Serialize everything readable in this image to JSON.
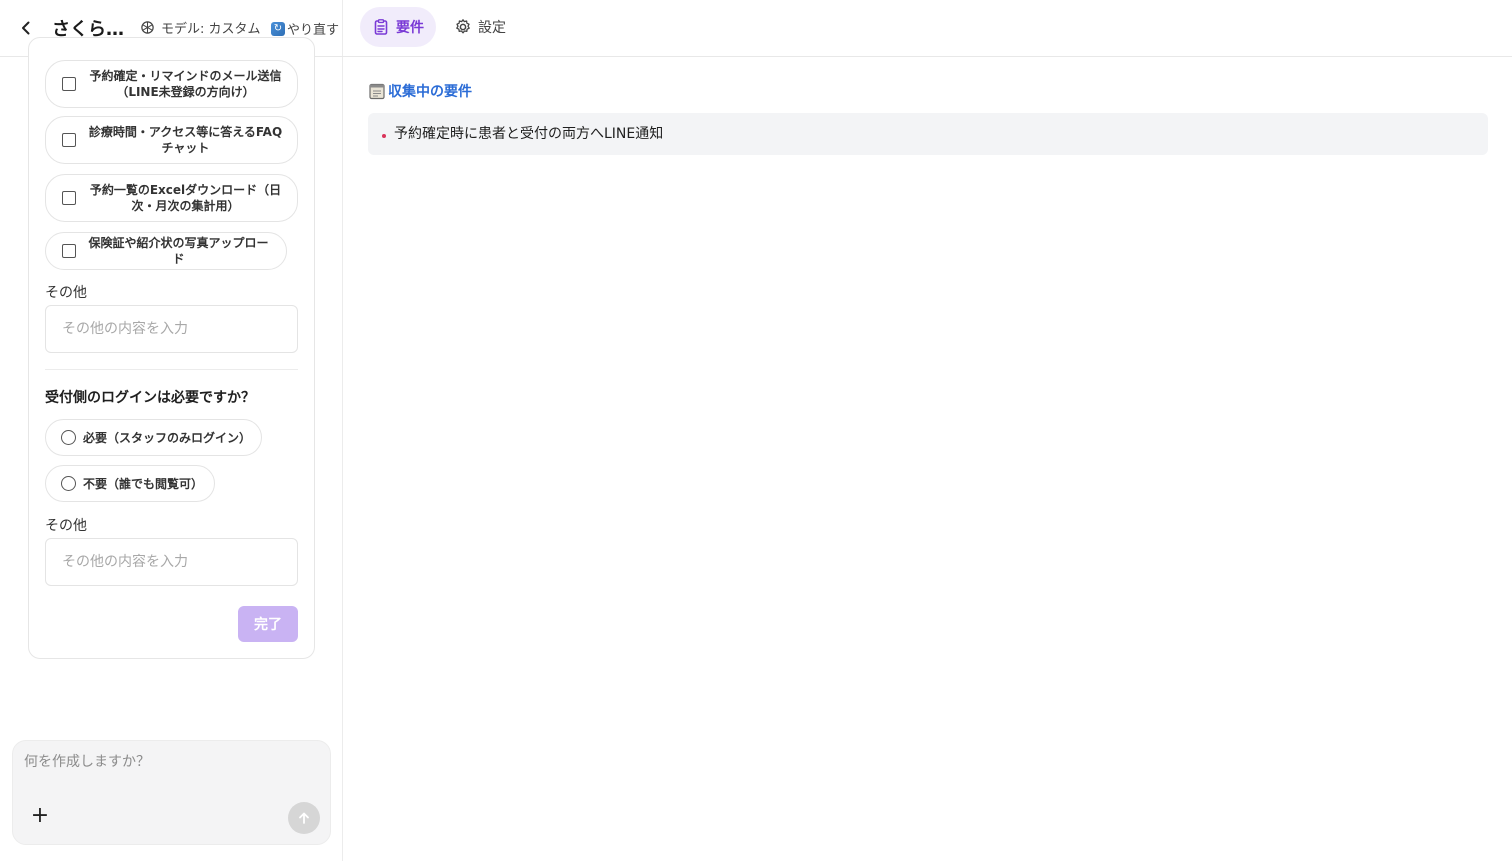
{
  "header": {
    "project_title": "さくら…",
    "model_label": "モデル: カスタム",
    "redo_label": "やり直す",
    "tabs": [
      {
        "label": "要件",
        "active": true
      },
      {
        "label": "設定",
        "active": false
      }
    ]
  },
  "form": {
    "feature_options": [
      "予約確定・リマインドのメール送信（LINE未登録の方向け）",
      "診療時間・アクセス等に答えるFAQチャット",
      "予約一覧のExcelダウンロード（日次・月次の集計用）",
      "保険証や紹介状の写真アップロード"
    ],
    "feature_options_lines": [
      [
        "予約確定・リマインドのメール送信",
        "（LINE未登録の方向け）"
      ],
      [
        "診療時間・アクセス等に答えるFAQ",
        "チャット"
      ],
      [
        "予約一覧のExcelダウンロード（日",
        "次・月次の集計用）"
      ],
      [
        "保険証や紹介状の写真アップロード"
      ]
    ],
    "other_label_1": "その他",
    "other_placeholder_1": "その他の内容を入力",
    "login_question": "受付側のログインは必要ですか？",
    "login_options": [
      "必要（スタッフのみログイン）",
      "不要（誰でも閲覧可）"
    ],
    "other_label_2": "その他",
    "other_placeholder_2": "その他の内容を入力",
    "done_label": "完了"
  },
  "composer": {
    "placeholder": "何を作成しますか？",
    "plus_label": "+"
  },
  "requirements": {
    "heading": "収集中の要件",
    "items": [
      "予約確定時に患者と受付の両方へLINE通知"
    ]
  },
  "colors": {
    "accent": "#7a3ad6",
    "accent_bg": "#f1ecfb",
    "heading_blue": "#2b6cd6",
    "done_disabled": "#c9b3f3",
    "bullet_red": "#d9345a"
  }
}
